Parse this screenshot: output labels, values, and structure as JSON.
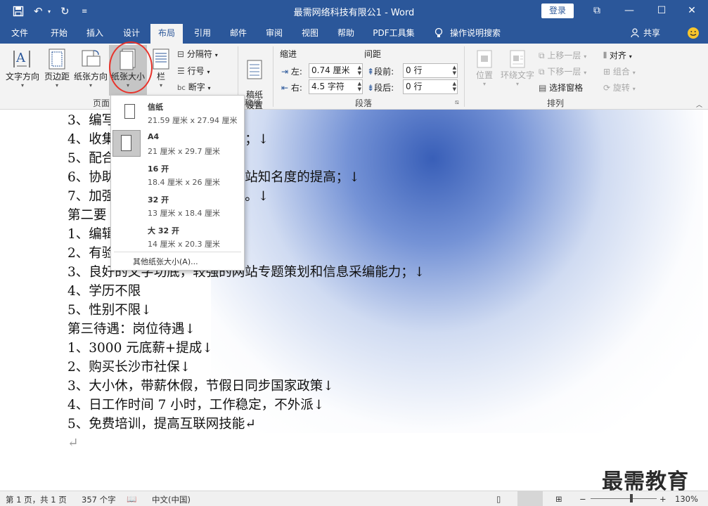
{
  "window": {
    "title": "最需网络科技有限公1 - Word",
    "login_label": "登录",
    "controls": [
      "⧉",
      "—",
      "☐",
      "✕"
    ]
  },
  "quick_access": {
    "save_icon": "save-icon",
    "undo_icon": "undo-icon",
    "redo_icon": "redo-icon"
  },
  "tabs": [
    "文件",
    "开始",
    "插入",
    "设计",
    "布局",
    "引用",
    "邮件",
    "审阅",
    "视图",
    "帮助",
    "PDF工具集"
  ],
  "active_tab": "布局",
  "tell_me": "操作说明搜索",
  "share_label": "共享",
  "ribbon": {
    "page_setup": {
      "text_direction": "文字方向",
      "margins": "页边距",
      "orientation": "纸张方向",
      "size": "纸张大小",
      "columns": "栏",
      "breaks": "分隔符",
      "line_numbers": "行号",
      "hyphenation": "断字",
      "group_label": "页面"
    },
    "manuscript": {
      "label": "稿纸\n设置",
      "group_label": "稿纸"
    },
    "paragraph": {
      "indent_title": "缩进",
      "spacing_title": "间距",
      "left_label": "左:",
      "left_value": "0.74 厘米",
      "right_label": "右:",
      "right_value": "4.5 字符",
      "before_label": "段前:",
      "before_value": "0 行",
      "after_label": "段后:",
      "after_value": "0 行",
      "group_label": "段落"
    },
    "arrange": {
      "position": "位置",
      "wrap_text": "环绕文字",
      "bring_forward": "上移一层",
      "send_backward": "下移一层",
      "selection_pane": "选择窗格",
      "align": "对齐",
      "group": "组合",
      "rotate": "旋转",
      "group_label": "排列"
    }
  },
  "paper_menu": {
    "options": [
      {
        "name": "信纸",
        "dims": "21.59 厘米 x 27.94 厘米",
        "selected": false
      },
      {
        "name": "A4",
        "dims": "21 厘米 x 29.7 厘米",
        "selected": true
      },
      {
        "name": "16 开",
        "dims": "18.4 厘米 x 26 厘米",
        "selected": false
      },
      {
        "name": "32 开",
        "dims": "13 厘米 x 18.4 厘米",
        "selected": false
      },
      {
        "name": "大 32 开",
        "dims": "14 厘米 x 20.3 厘米",
        "selected": false
      }
    ],
    "more": "其他纸张大小(A)..."
  },
  "document": {
    "lines": [
      "3、编写关产品资料；↓",
      "4、收集读者的意见和反馈信息；↓",
      "5、配合活动，并参与执行；↓",
      "6、协助目的发展规划，促进网站知名度的提高；↓",
      "7、加强组织外部的沟通与协作。↓",
      "第二要",
      "1、编辑文等相关专业优先；↓",
      "2、有验者优先；↓",
      "3、良好的文字功底，较强的网站专题策划和信息采编能力；↓",
      "4、学历不限",
      "5、性别不限↓",
      "第三待遇：岗位待遇↓",
      "1、3000 元底薪+提成↓",
      "2、购买长沙市社保↓",
      "3、大小休，带薪休假，节假日同步国家政策↓",
      "4、日工作时间 7 小时，工作稳定，不外派↓",
      "5、免费培训，提高互联网技能↵",
      "↵"
    ]
  },
  "status": {
    "page": "第 1 页，共 1 页",
    "words": "357 个字",
    "language": "中文(中国)",
    "zoom": "130%",
    "zoom_level": 0.62
  },
  "watermark": "最需教育",
  "colors": {
    "brand": "#2b579a",
    "highlight_circle": "#e8332b"
  }
}
